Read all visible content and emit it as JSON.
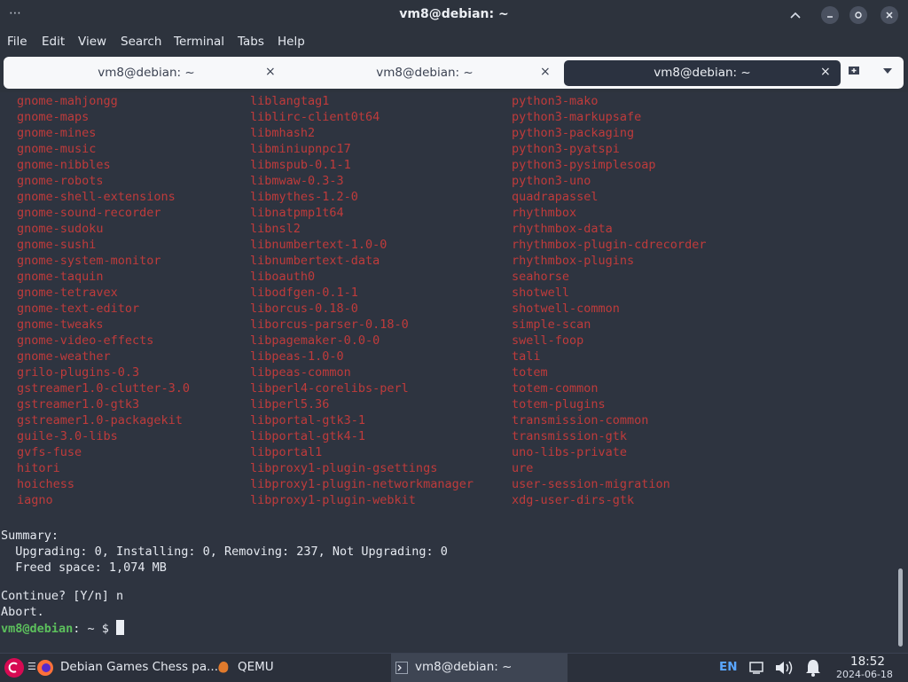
{
  "window": {
    "title": "vm8@debian: ~",
    "menu_dots": "⋯"
  },
  "menubar": [
    "File",
    "Edit",
    "View",
    "Search",
    "Terminal",
    "Tabs",
    "Help"
  ],
  "tabs": [
    {
      "label": "vm8@debian: ~",
      "close": "×",
      "active": false
    },
    {
      "label": "vm8@debian: ~",
      "close": "×",
      "active": false
    },
    {
      "label": "vm8@debian: ~",
      "close": "×",
      "active": true
    }
  ],
  "packages": {
    "col1": [
      "gnome-mahjongg",
      "gnome-maps",
      "gnome-mines",
      "gnome-music",
      "gnome-nibbles",
      "gnome-robots",
      "gnome-shell-extensions",
      "gnome-sound-recorder",
      "gnome-sudoku",
      "gnome-sushi",
      "gnome-system-monitor",
      "gnome-taquin",
      "gnome-tetravex",
      "gnome-text-editor",
      "gnome-tweaks",
      "gnome-video-effects",
      "gnome-weather",
      "grilo-plugins-0.3",
      "gstreamer1.0-clutter-3.0",
      "gstreamer1.0-gtk3",
      "gstreamer1.0-packagekit",
      "guile-3.0-libs",
      "gvfs-fuse",
      "hitori",
      "hoichess",
      "iagno"
    ],
    "col2": [
      "liblangtag1",
      "liblirc-client0t64",
      "libmhash2",
      "libminiupnpc17",
      "libmspub-0.1-1",
      "libmwaw-0.3-3",
      "libmythes-1.2-0",
      "libnatpmp1t64",
      "libnsl2",
      "libnumbertext-1.0-0",
      "libnumbertext-data",
      "liboauth0",
      "libodfgen-0.1-1",
      "liborcus-0.18-0",
      "liborcus-parser-0.18-0",
      "libpagemaker-0.0-0",
      "libpeas-1.0-0",
      "libpeas-common",
      "libperl4-corelibs-perl",
      "libperl5.36",
      "libportal-gtk3-1",
      "libportal-gtk4-1",
      "libportal1",
      "libproxy1-plugin-gsettings",
      "libproxy1-plugin-networkmanager",
      "libproxy1-plugin-webkit"
    ],
    "col3": [
      "python3-mako",
      "python3-markupsafe",
      "python3-packaging",
      "python3-pyatspi",
      "python3-pysimplesoap",
      "python3-uno",
      "quadrapassel",
      "rhythmbox",
      "rhythmbox-data",
      "rhythmbox-plugin-cdrecorder",
      "rhythmbox-plugins",
      "seahorse",
      "shotwell",
      "shotwell-common",
      "simple-scan",
      "swell-foop",
      "tali",
      "totem",
      "totem-common",
      "totem-plugins",
      "transmission-common",
      "transmission-gtk",
      "uno-libs-private",
      "ure",
      "user-session-migration",
      "xdg-user-dirs-gtk"
    ]
  },
  "output": {
    "summary": "Summary:",
    "counts": "  Upgrading: 0, Installing: 0, Removing: 237, Not Upgrading: 0",
    "freed": "  Freed space: 1,074 MB",
    "continue": "Continue? [Y/n] n",
    "abort": "Abort."
  },
  "prompt": {
    "user_host": "vm8@debian",
    "rest": ": ~ $ "
  },
  "taskbar": {
    "firefox_label": "Debian Games Chess pa...",
    "qemu_label": "QEMU",
    "terminal_label": "vm8@debian: ~",
    "lang": "EN",
    "time": "18:52",
    "date": "2024-06-18"
  },
  "colors": {
    "package_red": "#bf3b3b",
    "prompt_green": "#5cc05c",
    "debian_red": "#d70a53",
    "background": "#2e3440"
  }
}
